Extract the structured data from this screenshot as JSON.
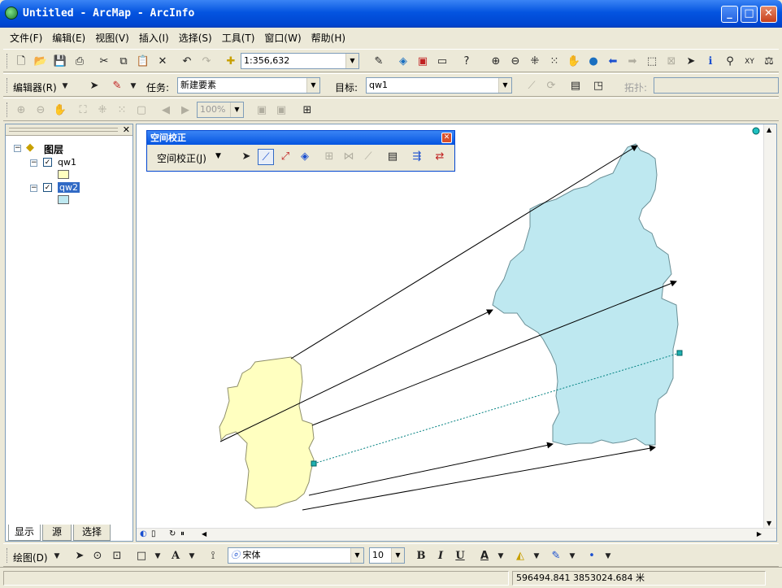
{
  "window": {
    "title": "Untitled - ArcMap - ArcInfo"
  },
  "menu": [
    "文件(F)",
    "编辑(E)",
    "视图(V)",
    "插入(I)",
    "选择(S)",
    "工具(T)",
    "窗口(W)",
    "帮助(H)"
  ],
  "standard_toolbar": {
    "scale": "1:356,632"
  },
  "editor_toolbar": {
    "editor_label": "编辑器(R)",
    "task_label": "任务:",
    "task_value": "新建要素",
    "target_label": "目标:",
    "target_value": "qw1",
    "topology_label": "拓扑:"
  },
  "tools_toolbar": {
    "zoom_value": "100%"
  },
  "toc": {
    "root_label": "图层",
    "layers": [
      {
        "name": "qw1",
        "checked": true,
        "fill": "#ffffc0"
      },
      {
        "name": "qw2",
        "checked": true,
        "fill": "#bee8f0",
        "selected": true
      }
    ],
    "tabs": [
      "显示",
      "源",
      "选择"
    ]
  },
  "spatial_adjustment": {
    "title": "空间校正",
    "menu_label": "空间校正(J)"
  },
  "drawing_toolbar": {
    "draw_label": "绘图(D)",
    "font": "宋体",
    "font_size": "10",
    "bold": "B",
    "italic": "I",
    "underline": "U"
  },
  "status": {
    "coordinates": "596494.841  3853024.684 米"
  },
  "colors": {
    "source_fill": "#ffffc0",
    "target_fill": "#bee8f0",
    "link": "#000000",
    "selected_link": "#008080"
  }
}
